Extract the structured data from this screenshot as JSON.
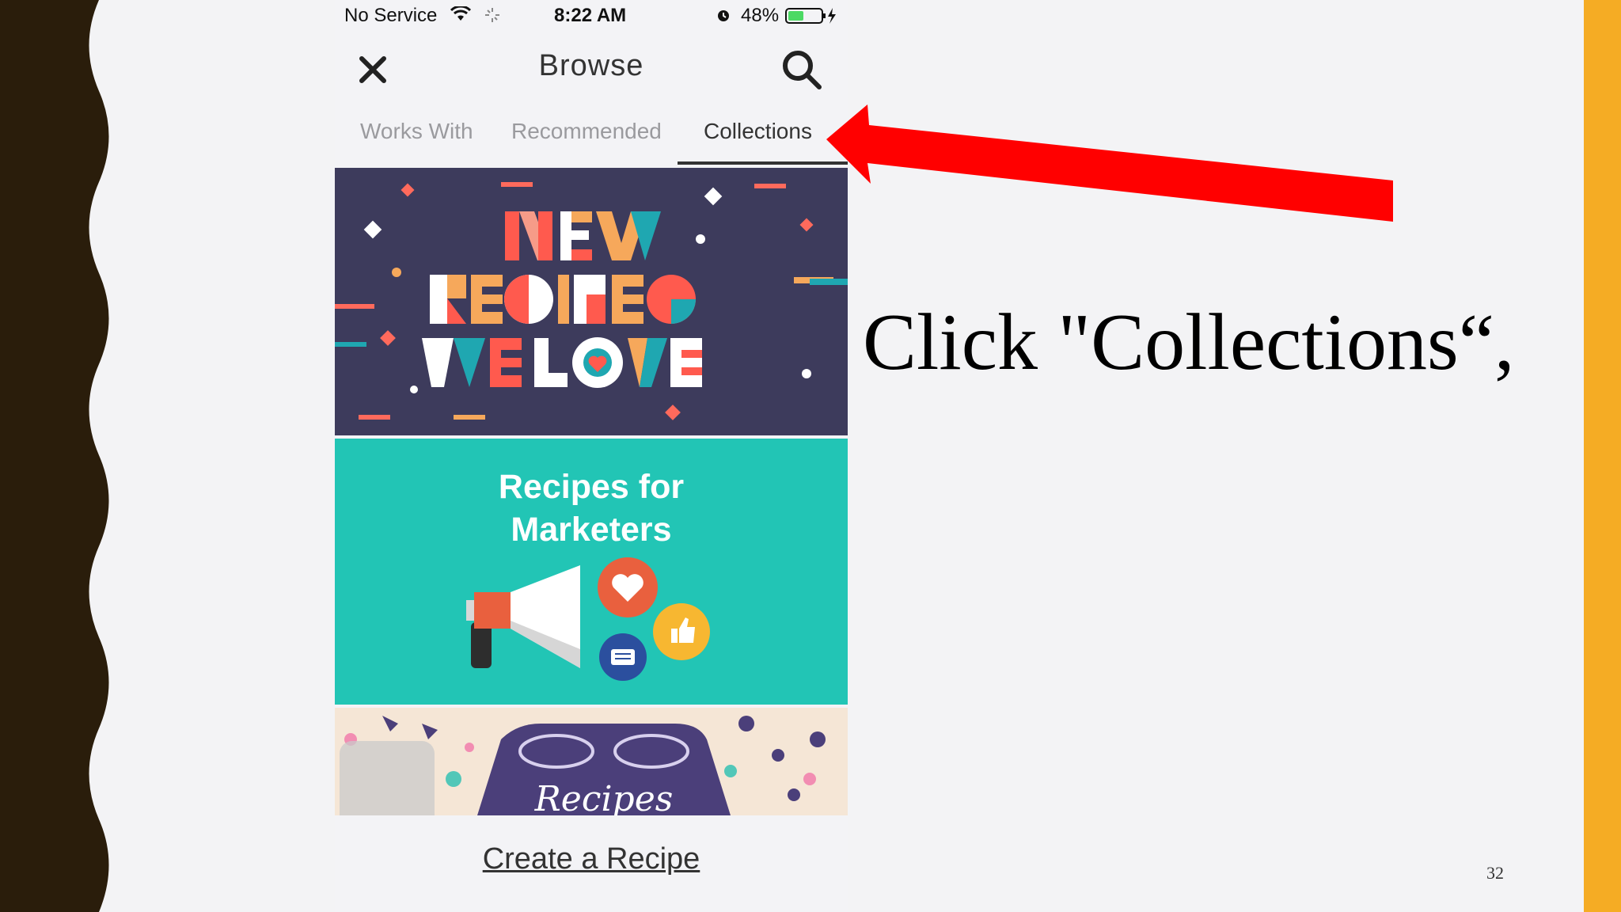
{
  "status_bar": {
    "carrier": "No Service",
    "time": "8:22 AM",
    "battery_percent": "48%",
    "battery_level": 0.48,
    "icons": [
      "wifi-icon",
      "loading-icon",
      "alarm-icon",
      "battery-icon",
      "charging-icon"
    ]
  },
  "nav": {
    "title": "Browse",
    "close_icon": "close-icon",
    "search_icon": "search-icon"
  },
  "tabs": [
    {
      "label": "Works With",
      "active": false
    },
    {
      "label": "Recommended",
      "active": false
    },
    {
      "label": "Collections",
      "active": true
    }
  ],
  "cards": [
    {
      "name": "new-recipes-we-love",
      "text_art": "NEW RECIPES WE LOVE"
    },
    {
      "name": "recipes-for-marketers",
      "title_line1": "Recipes for",
      "title_line2": "Marketers"
    },
    {
      "name": "recipes-collection",
      "text_art": "Recipes"
    }
  ],
  "footer": {
    "create_recipe": "Create a Recipe"
  },
  "slide": {
    "instruction": "Click \"Collections“,",
    "page_number": "32"
  },
  "colors": {
    "accent_orange": "#f5ac24",
    "arrow_red": "#ff0000",
    "dark_band": "#2a1d0b",
    "marketers_bg": "#22c5b5",
    "new_recipes_bg": "#3d3b5c"
  }
}
